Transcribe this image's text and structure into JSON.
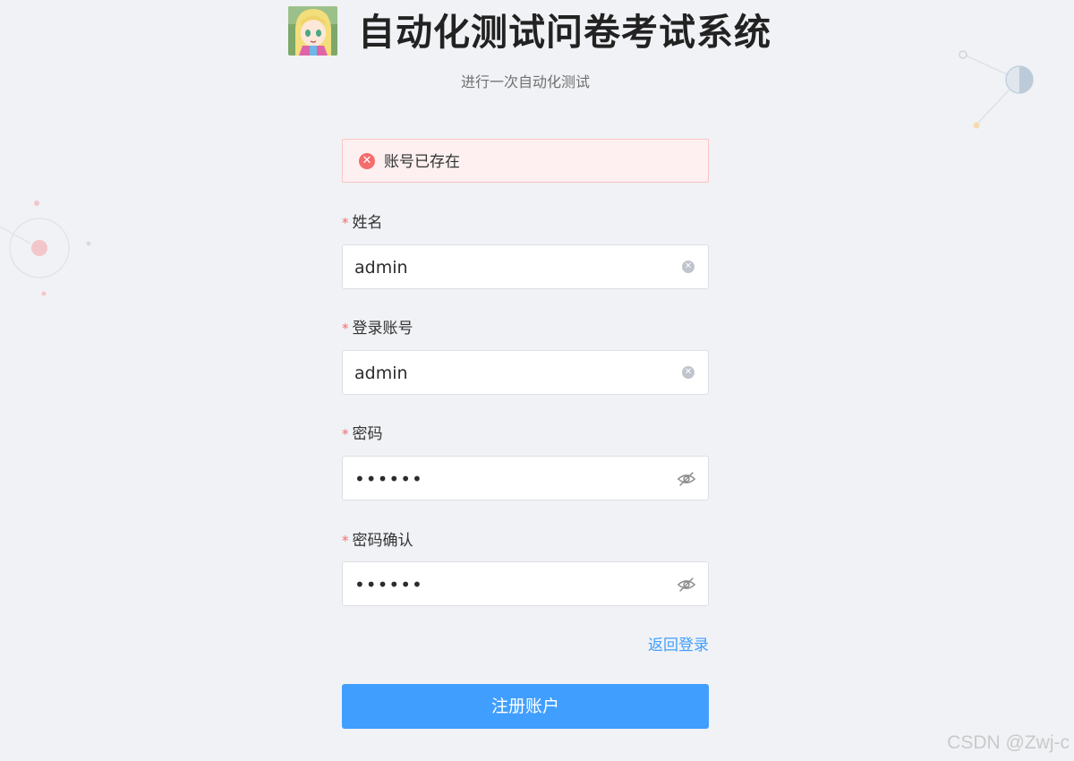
{
  "header": {
    "avatar_icon": "anime-girl-avatar-icon",
    "title": "自动化测试问卷考试系统",
    "subtitle": "进行一次自动化测试"
  },
  "alert": {
    "icon": "error-circle-icon",
    "message": "账号已存在",
    "color": "#f56c6c"
  },
  "form": {
    "fields": [
      {
        "label": "姓名",
        "value": "admin",
        "required": true,
        "suffix_icon": "clear-icon"
      },
      {
        "label": "登录账号",
        "value": "admin",
        "required": true,
        "suffix_icon": "clear-icon"
      },
      {
        "label": "密码",
        "value": "••••••",
        "required": true,
        "suffix_icon": "eye-hidden-icon"
      },
      {
        "label": "密码确认",
        "value": "••••••",
        "required": true,
        "suffix_icon": "eye-hidden-icon"
      }
    ],
    "required_mark": "*",
    "back_link": "返回登录",
    "submit_label": "注册账户"
  },
  "colors": {
    "primary": "#409eff",
    "danger": "#f56c6c",
    "background": "#f0f2f5"
  },
  "watermark": "CSDN @Zwj-c"
}
